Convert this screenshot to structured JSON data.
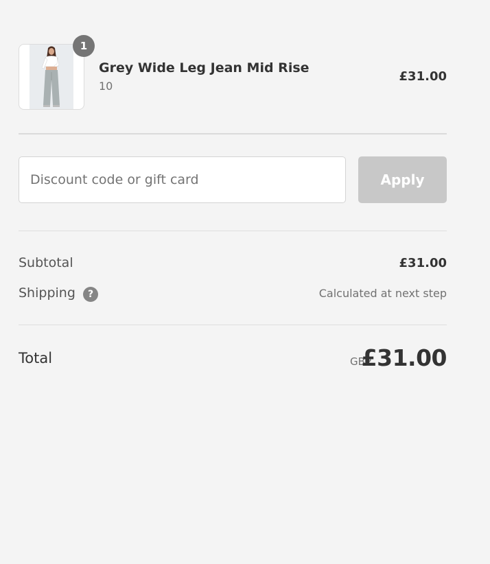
{
  "cart": {
    "items": [
      {
        "quantity": "1",
        "name": "Grey Wide Leg Jean Mid Rise",
        "variant": "10",
        "price": "£31.00"
      }
    ]
  },
  "discount": {
    "placeholder": "Discount code or gift card",
    "value": "",
    "apply_label": "Apply"
  },
  "costs": {
    "subtotal_label": "Subtotal",
    "subtotal_value": "£31.00",
    "shipping_label": "Shipping",
    "shipping_help_glyph": "?",
    "shipping_value": "Calculated at next step",
    "total_label": "Total",
    "currency": "GBP",
    "total_value": "£31.00"
  },
  "colors": {
    "page_background": "#f4f4f4",
    "badge": "#757575",
    "apply_disabled": "#c8c8c8"
  },
  "icons": {
    "product_image": "product-thumbnail-image",
    "help": "help-icon"
  }
}
